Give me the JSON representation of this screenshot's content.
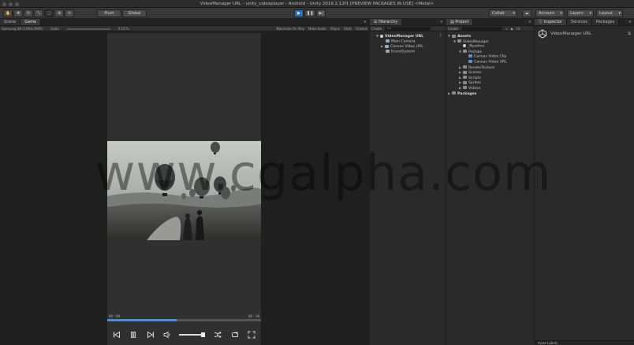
{
  "window": {
    "title": "VideoManager URL - unity_videoplayer - Android - Unity 2019.2.12f1 [PREVIEW PACKAGES IN USE] <Metal>"
  },
  "toolbar": {
    "tools": [
      "hand-icon",
      "move-icon",
      "rotate-icon",
      "scale-icon",
      "rect-icon",
      "transform-icon",
      "custom-tool-icon"
    ],
    "pivot_label": "Pivot",
    "global_label": "Global",
    "play_icons": [
      "play-icon",
      "pause-icon",
      "step-icon"
    ],
    "collab_label": "Collab",
    "account_label": "Account",
    "layers_label": "Layers",
    "layout_label": "Layout"
  },
  "game": {
    "tabs": [
      "Scene",
      "Game"
    ],
    "active_tab": "Game",
    "device_label": "Samsung S8 (1440x2960)",
    "scale_label": "Scale",
    "scale_value": "0.217x",
    "options": [
      "Maximize On Play",
      "Mute Audio",
      "VSync",
      "Stats",
      "Gizmos"
    ],
    "time_current": "00 : 00",
    "time_total": "00 : 16",
    "progress": 0.45
  },
  "hierarchy": {
    "tab": "Hierarchy",
    "create_label": "Create",
    "search_prefix": "All",
    "scene": "VideoManager URL",
    "items": [
      "Main Camera",
      "Canvas Video URL",
      "EventSystem"
    ]
  },
  "project": {
    "tab": "Project",
    "create_label": "Create",
    "root": "Assets",
    "tree": [
      {
        "label": "VideoManager",
        "depth": 1,
        "type": "folder",
        "expanded": true
      },
      {
        "label": "_Readme",
        "depth": 2,
        "type": "unity"
      },
      {
        "label": "Prefabs",
        "depth": 2,
        "type": "folder",
        "expanded": true
      },
      {
        "label": "Canvas Video Clip",
        "depth": 3,
        "type": "prefab"
      },
      {
        "label": "Canvas Video URL",
        "depth": 3,
        "type": "prefab"
      },
      {
        "label": "RenderTexture",
        "depth": 2,
        "type": "folder"
      },
      {
        "label": "Scenes",
        "depth": 2,
        "type": "folder"
      },
      {
        "label": "Scripts",
        "depth": 2,
        "type": "folder"
      },
      {
        "label": "Sprites",
        "depth": 2,
        "type": "folder"
      },
      {
        "label": "Videos",
        "depth": 2,
        "type": "folder"
      }
    ],
    "packages": "Packages",
    "count_badge": "14"
  },
  "inspector": {
    "tabs": [
      "Inspector",
      "Services",
      "Packages"
    ],
    "title": "VideoManager URL",
    "asset_labels": "Asset Labels"
  },
  "watermark": "www.cgalpha.com"
}
